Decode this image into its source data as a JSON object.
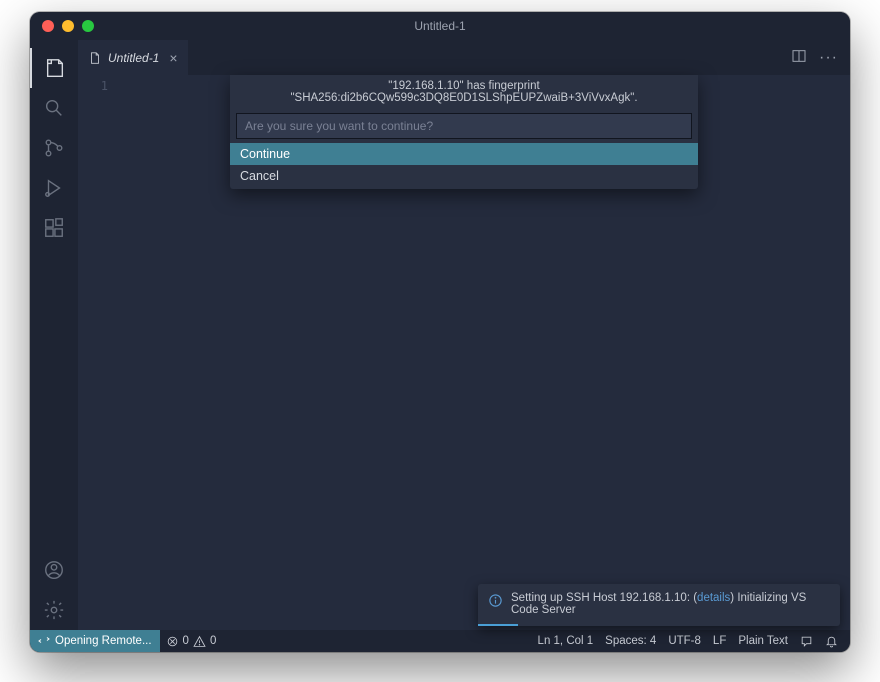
{
  "window": {
    "title": "Untitled-1"
  },
  "tabs": {
    "active": {
      "label": "Untitled-1"
    }
  },
  "editor": {
    "line_number": "1"
  },
  "quickinput": {
    "title": "\"192.168.1.10\" has fingerprint \"SHA256:di2b6CQw599c3DQ8E0D1SLShpEUPZwaiB+3ViVvxAgk\".",
    "placeholder": "Are you sure you want to continue?",
    "options": [
      {
        "label": "Continue",
        "selected": true
      },
      {
        "label": "Cancel",
        "selected": false
      }
    ]
  },
  "notification": {
    "text_prefix": "Setting up SSH Host 192.168.1.10: (",
    "link_text": "details",
    "text_suffix": ") Initializing VS Code Server"
  },
  "statusbar": {
    "remote": "Opening Remote...",
    "errors": "0",
    "warnings": "0",
    "cursor": "Ln 1, Col 1",
    "spaces": "Spaces: 4",
    "encoding": "UTF-8",
    "eol": "LF",
    "language": "Plain Text"
  }
}
